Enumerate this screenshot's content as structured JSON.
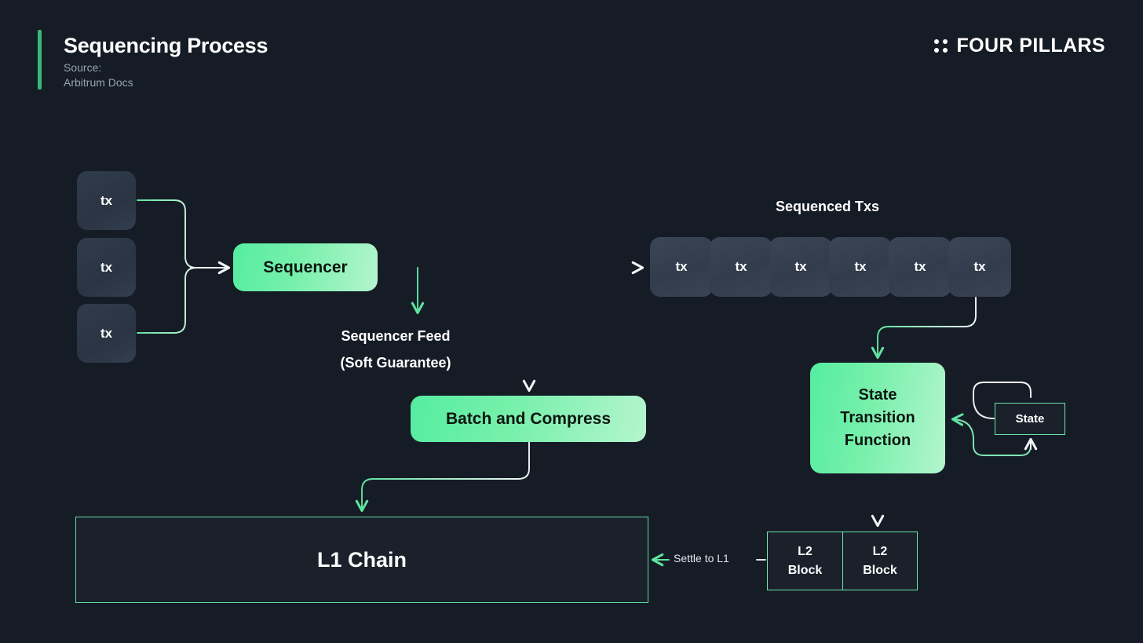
{
  "header": {
    "title": "Sequencing Process",
    "source_label": "Source:",
    "source_value": "Arbitrum Docs",
    "brand": "FOUR PILLARS",
    "accent_color": "#3ab87a"
  },
  "diagram": {
    "incoming_txs": [
      {
        "label": "tx"
      },
      {
        "label": "tx"
      },
      {
        "label": "tx"
      }
    ],
    "sequencer": {
      "label": "Sequencer"
    },
    "sequencer_feed": {
      "line1": "Sequencer Feed",
      "line2": "(Soft Guarantee)"
    },
    "batch_and_compress": {
      "label": "Batch and Compress"
    },
    "sequenced_txs": {
      "title": "Sequenced Txs",
      "items": [
        {
          "label": "tx"
        },
        {
          "label": "tx"
        },
        {
          "label": "tx"
        },
        {
          "label": "tx"
        },
        {
          "label": "tx"
        },
        {
          "label": "tx"
        }
      ]
    },
    "state_transition_function": {
      "line1": "State",
      "line2": "Transition",
      "line3": "Function"
    },
    "state": {
      "label": "State"
    },
    "l2_blocks": [
      {
        "line1": "L2",
        "line2": "Block"
      },
      {
        "line1": "L2",
        "line2": "Block"
      }
    ],
    "l1_chain": {
      "label": "L1 Chain"
    },
    "settle_to_l1": {
      "label": "Settle to L1"
    }
  },
  "colors": {
    "background": "#161c26",
    "accent_green": "#5fe3a0",
    "node_green_start": "#55eda1",
    "node_green_end": "#b4f5ce",
    "tx_box": "#2f3a4a",
    "wire_white": "#f2f5f7"
  }
}
